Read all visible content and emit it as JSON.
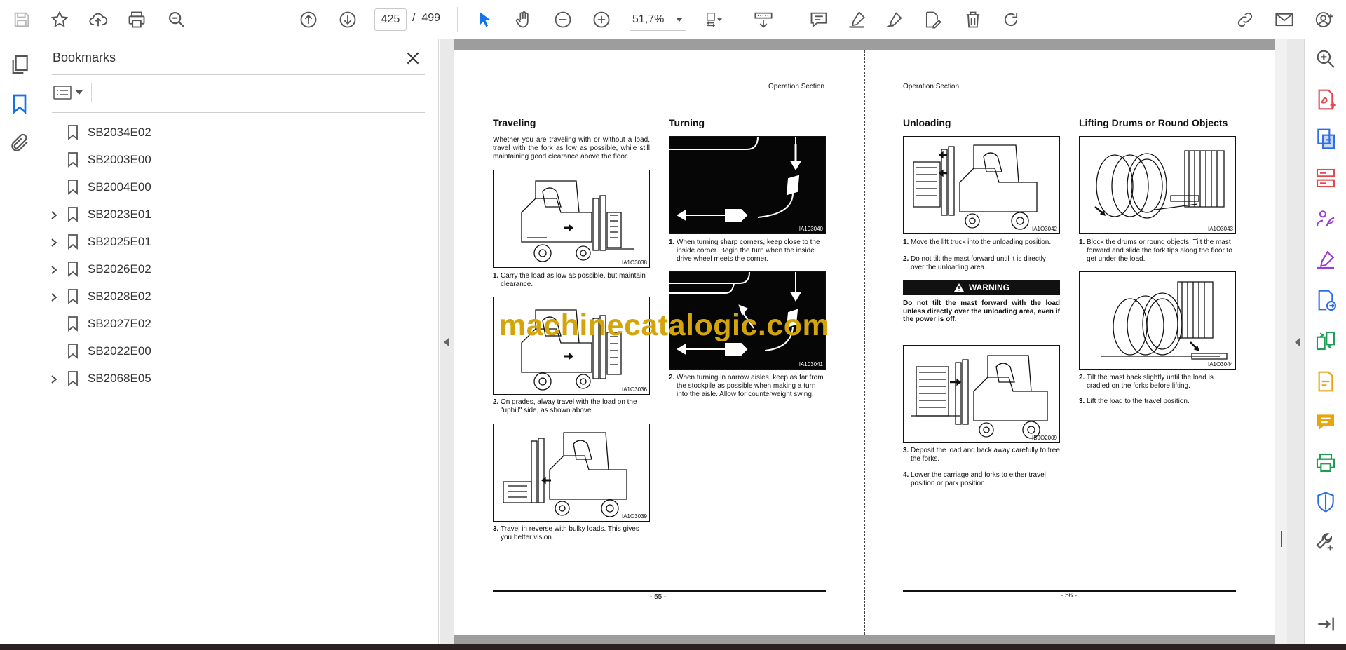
{
  "toolbar": {
    "page_current": "425",
    "page_separator": "/",
    "page_total": "499",
    "zoom": "51,7%"
  },
  "bookmarks": {
    "title": "Bookmarks",
    "items": [
      {
        "label": "SB2034E02",
        "expandable": false,
        "selected": true
      },
      {
        "label": "SB2003E00",
        "expandable": false,
        "selected": false
      },
      {
        "label": "SB2004E00",
        "expandable": false,
        "selected": false
      },
      {
        "label": "SB2023E01",
        "expandable": true,
        "selected": false
      },
      {
        "label": "SB2025E01",
        "expandable": true,
        "selected": false
      },
      {
        "label": "SB2026E02",
        "expandable": true,
        "selected": false
      },
      {
        "label": "SB2028E02",
        "expandable": true,
        "selected": false
      },
      {
        "label": "SB2027E02",
        "expandable": false,
        "selected": false
      },
      {
        "label": "SB2022E00",
        "expandable": false,
        "selected": false
      },
      {
        "label": "SB2068E05",
        "expandable": true,
        "selected": false
      }
    ]
  },
  "document": {
    "left_page": {
      "header": "Operation Section",
      "traveling": {
        "heading": "Traveling",
        "intro": "Whether you are traveling with or without a load, travel with the fork as low as possible, while still maintaining good clearance above the floor.",
        "figs": [
          "IA1O3038",
          "IA1O3036",
          "IA1O3039"
        ],
        "steps": [
          {
            "num": "1.",
            "text": "Carry the load as low as possible, but maintain clearance."
          },
          {
            "num": "2.",
            "text": "On grades, alway travel with the load on the \"uphill\" side, as shown above."
          },
          {
            "num": "3.",
            "text": "Travel in reverse with bulky loads. This gives you better vision."
          }
        ]
      },
      "turning": {
        "heading": "Turning",
        "figs": [
          "IA103040",
          "IA103041"
        ],
        "steps": [
          {
            "num": "1.",
            "text": "When turning sharp corners, keep close to the inside corner. Begin the turn when the inside drive wheel meets the corner."
          },
          {
            "num": "2.",
            "text": "When turning in narrow aisles, keep as far from the stockpile as possible when making a turn into the aisle. Allow for counterweight swing."
          }
        ]
      },
      "page_number": "- 55 -"
    },
    "right_page": {
      "header": "Operation Section",
      "unloading": {
        "heading": "Unloading",
        "figs": [
          "IA1O3042",
          "IB9O2009"
        ],
        "steps": [
          {
            "num": "1.",
            "text": "Move the lift truck into the unloading position."
          },
          {
            "num": "2.",
            "text": "Do not tilt the mast forward until it is directly over the unloading area."
          },
          {
            "num": "3.",
            "text": "Deposit the load and back away carefully to free the forks."
          },
          {
            "num": "4.",
            "text": "Lower the carriage and forks to either travel position or park position."
          }
        ],
        "warning_label": "WARNING",
        "warning_text": "Do not tilt the mast forward with the load unless directly over the unloading area, even if the power is off."
      },
      "drums": {
        "heading": "Lifting Drums or Round Objects",
        "figs": [
          "IA1O3043",
          "IA1O3044"
        ],
        "steps": [
          {
            "num": "1.",
            "text": "Block the drums or round objects. Tilt the mast forward and slide the fork tips along the floor to get under the load."
          },
          {
            "num": "2.",
            "text": "Tilt the mast back slightly until the load is cradled on the forks before lifting."
          },
          {
            "num": "3.",
            "text": "Lift the load to the travel position."
          }
        ]
      },
      "page_number": "- 56 -"
    },
    "watermark": "machinecatalogic.com"
  },
  "colors": {
    "accent_blue": "#1473e6",
    "rail_pink": "#e34850",
    "rail_blue": "#2d6ee8",
    "rail_purple": "#9a3fd1",
    "rail_green": "#1f9d55",
    "rail_yellow": "#e8a60c",
    "watermark": "#d4a50b"
  }
}
